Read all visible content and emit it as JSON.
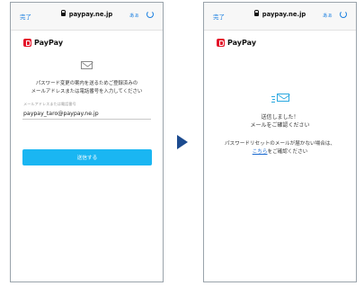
{
  "left_screen": {
    "topbar": {
      "done": "完了",
      "url": "paypay.ne.jp",
      "aa": "あぁ"
    },
    "brand": "PayPay",
    "instruction": [
      "パスワード変更の案内を送るためご登録済みの",
      "メールアドレスまたは電話番号を入力してください"
    ],
    "field": {
      "label": "メールアドレスまたは電話番号",
      "value": "paypay_taro@paypay.ne.jp"
    },
    "button": "送信する"
  },
  "right_screen": {
    "topbar": {
      "done": "完了",
      "url": "paypay.ne.jp",
      "aa": "あぁ"
    },
    "brand": "PayPay",
    "sent": [
      "送信しました！",
      "メールをご確認ください"
    ],
    "reset_line1": "パスワードリセットのメールが届かない場合は、",
    "reset_link": "こちら",
    "reset_tail": "をご確認ください"
  },
  "colors": {
    "accent": "#1ab6f2",
    "brand": "#e4152a",
    "link": "#1a6ad0",
    "arrow": "#1c4b8f"
  },
  "icons": [
    "lock-icon",
    "reload-icon",
    "paypay-logo-icon",
    "envelope-icon",
    "sent-envelope-icon",
    "arrow-right-icon"
  ]
}
